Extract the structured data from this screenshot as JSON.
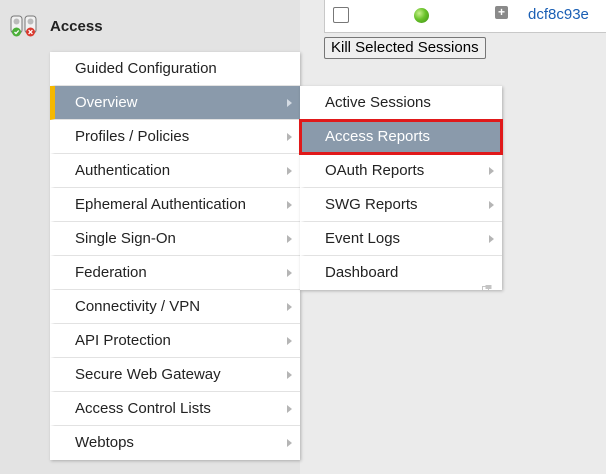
{
  "header": {
    "title": "Access",
    "icon": "access-lights-icon"
  },
  "session_row": {
    "session_id": "dcf8c93e",
    "status": "green",
    "checked": false
  },
  "kill_button_label": "Kill Selected Sessions",
  "menu": {
    "items": [
      {
        "label": "Guided Configuration",
        "has_submenu": false
      },
      {
        "label": "Overview",
        "has_submenu": true,
        "active": true
      },
      {
        "label": "Profiles / Policies",
        "has_submenu": true
      },
      {
        "label": "Authentication",
        "has_submenu": true
      },
      {
        "label": "Ephemeral Authentication",
        "has_submenu": true
      },
      {
        "label": "Single Sign-On",
        "has_submenu": true
      },
      {
        "label": "Federation",
        "has_submenu": true
      },
      {
        "label": "Connectivity / VPN",
        "has_submenu": true
      },
      {
        "label": "API Protection",
        "has_submenu": true
      },
      {
        "label": "Secure Web Gateway",
        "has_submenu": true
      },
      {
        "label": "Access Control Lists",
        "has_submenu": true
      },
      {
        "label": "Webtops",
        "has_submenu": true
      }
    ]
  },
  "submenu": {
    "items": [
      {
        "label": "Active Sessions",
        "has_submenu": false
      },
      {
        "label": "Access Reports",
        "has_submenu": false,
        "selected": true,
        "highlighted": true
      },
      {
        "label": "OAuth Reports",
        "has_submenu": true
      },
      {
        "label": "SWG Reports",
        "has_submenu": true
      },
      {
        "label": "Event Logs",
        "has_submenu": true
      },
      {
        "label": "Dashboard",
        "has_submenu": false,
        "popout": true
      }
    ]
  },
  "colors": {
    "menu_active_bg": "#8a9aab",
    "active_accent": "#f5b800",
    "highlight_border": "#e0191a",
    "link": "#1a5fb4"
  }
}
